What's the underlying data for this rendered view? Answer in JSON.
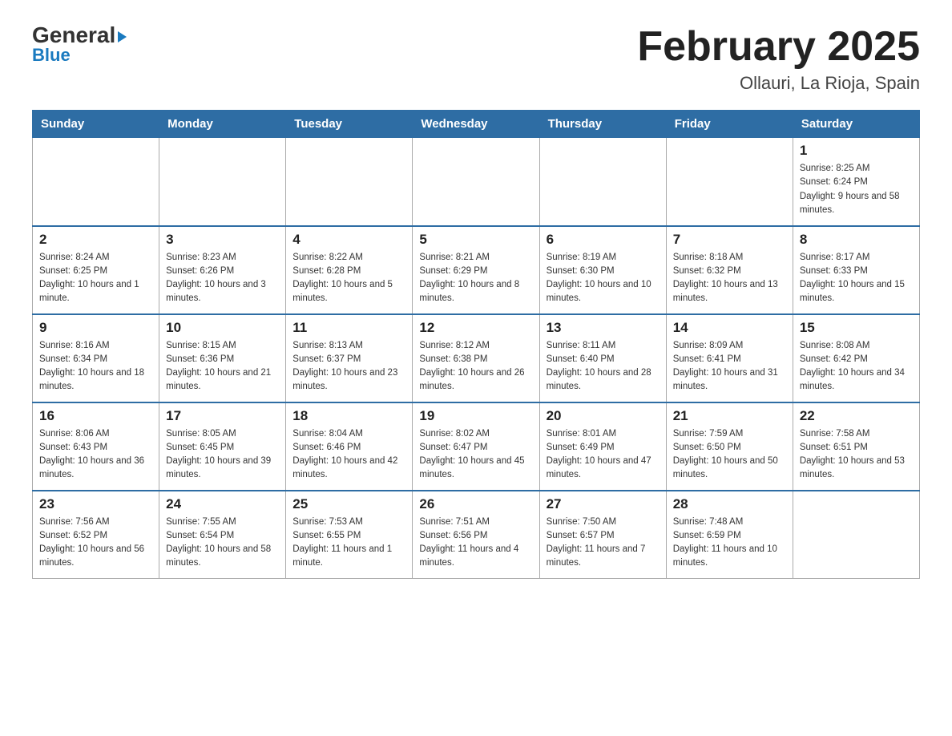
{
  "header": {
    "logo_general": "General",
    "logo_blue": "Blue",
    "title": "February 2025",
    "subtitle": "Ollauri, La Rioja, Spain"
  },
  "weekdays": [
    "Sunday",
    "Monday",
    "Tuesday",
    "Wednesday",
    "Thursday",
    "Friday",
    "Saturday"
  ],
  "weeks": [
    [
      {
        "day": "",
        "info": ""
      },
      {
        "day": "",
        "info": ""
      },
      {
        "day": "",
        "info": ""
      },
      {
        "day": "",
        "info": ""
      },
      {
        "day": "",
        "info": ""
      },
      {
        "day": "",
        "info": ""
      },
      {
        "day": "1",
        "info": "Sunrise: 8:25 AM\nSunset: 6:24 PM\nDaylight: 9 hours and 58 minutes."
      }
    ],
    [
      {
        "day": "2",
        "info": "Sunrise: 8:24 AM\nSunset: 6:25 PM\nDaylight: 10 hours and 1 minute."
      },
      {
        "day": "3",
        "info": "Sunrise: 8:23 AM\nSunset: 6:26 PM\nDaylight: 10 hours and 3 minutes."
      },
      {
        "day": "4",
        "info": "Sunrise: 8:22 AM\nSunset: 6:28 PM\nDaylight: 10 hours and 5 minutes."
      },
      {
        "day": "5",
        "info": "Sunrise: 8:21 AM\nSunset: 6:29 PM\nDaylight: 10 hours and 8 minutes."
      },
      {
        "day": "6",
        "info": "Sunrise: 8:19 AM\nSunset: 6:30 PM\nDaylight: 10 hours and 10 minutes."
      },
      {
        "day": "7",
        "info": "Sunrise: 8:18 AM\nSunset: 6:32 PM\nDaylight: 10 hours and 13 minutes."
      },
      {
        "day": "8",
        "info": "Sunrise: 8:17 AM\nSunset: 6:33 PM\nDaylight: 10 hours and 15 minutes."
      }
    ],
    [
      {
        "day": "9",
        "info": "Sunrise: 8:16 AM\nSunset: 6:34 PM\nDaylight: 10 hours and 18 minutes."
      },
      {
        "day": "10",
        "info": "Sunrise: 8:15 AM\nSunset: 6:36 PM\nDaylight: 10 hours and 21 minutes."
      },
      {
        "day": "11",
        "info": "Sunrise: 8:13 AM\nSunset: 6:37 PM\nDaylight: 10 hours and 23 minutes."
      },
      {
        "day": "12",
        "info": "Sunrise: 8:12 AM\nSunset: 6:38 PM\nDaylight: 10 hours and 26 minutes."
      },
      {
        "day": "13",
        "info": "Sunrise: 8:11 AM\nSunset: 6:40 PM\nDaylight: 10 hours and 28 minutes."
      },
      {
        "day": "14",
        "info": "Sunrise: 8:09 AM\nSunset: 6:41 PM\nDaylight: 10 hours and 31 minutes."
      },
      {
        "day": "15",
        "info": "Sunrise: 8:08 AM\nSunset: 6:42 PM\nDaylight: 10 hours and 34 minutes."
      }
    ],
    [
      {
        "day": "16",
        "info": "Sunrise: 8:06 AM\nSunset: 6:43 PM\nDaylight: 10 hours and 36 minutes."
      },
      {
        "day": "17",
        "info": "Sunrise: 8:05 AM\nSunset: 6:45 PM\nDaylight: 10 hours and 39 minutes."
      },
      {
        "day": "18",
        "info": "Sunrise: 8:04 AM\nSunset: 6:46 PM\nDaylight: 10 hours and 42 minutes."
      },
      {
        "day": "19",
        "info": "Sunrise: 8:02 AM\nSunset: 6:47 PM\nDaylight: 10 hours and 45 minutes."
      },
      {
        "day": "20",
        "info": "Sunrise: 8:01 AM\nSunset: 6:49 PM\nDaylight: 10 hours and 47 minutes."
      },
      {
        "day": "21",
        "info": "Sunrise: 7:59 AM\nSunset: 6:50 PM\nDaylight: 10 hours and 50 minutes."
      },
      {
        "day": "22",
        "info": "Sunrise: 7:58 AM\nSunset: 6:51 PM\nDaylight: 10 hours and 53 minutes."
      }
    ],
    [
      {
        "day": "23",
        "info": "Sunrise: 7:56 AM\nSunset: 6:52 PM\nDaylight: 10 hours and 56 minutes."
      },
      {
        "day": "24",
        "info": "Sunrise: 7:55 AM\nSunset: 6:54 PM\nDaylight: 10 hours and 58 minutes."
      },
      {
        "day": "25",
        "info": "Sunrise: 7:53 AM\nSunset: 6:55 PM\nDaylight: 11 hours and 1 minute."
      },
      {
        "day": "26",
        "info": "Sunrise: 7:51 AM\nSunset: 6:56 PM\nDaylight: 11 hours and 4 minutes."
      },
      {
        "day": "27",
        "info": "Sunrise: 7:50 AM\nSunset: 6:57 PM\nDaylight: 11 hours and 7 minutes."
      },
      {
        "day": "28",
        "info": "Sunrise: 7:48 AM\nSunset: 6:59 PM\nDaylight: 11 hours and 10 minutes."
      },
      {
        "day": "",
        "info": ""
      }
    ]
  ]
}
